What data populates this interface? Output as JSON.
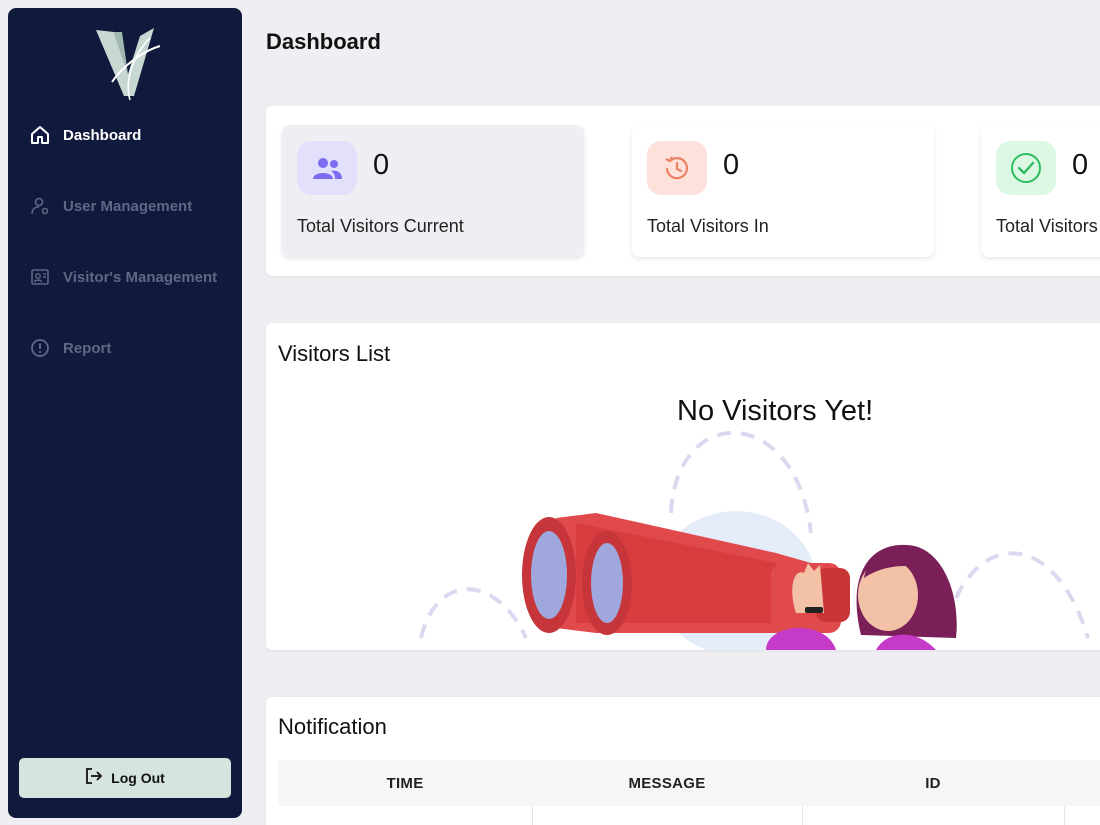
{
  "sidebar": {
    "items": [
      {
        "label": "Dashboard",
        "icon": "home-icon",
        "active": true
      },
      {
        "label": "User Management",
        "icon": "user-gear-icon",
        "active": false
      },
      {
        "label": "Visitor's Management",
        "icon": "id-card-icon",
        "active": false
      },
      {
        "label": "Report",
        "icon": "alert-circle-icon",
        "active": false
      }
    ],
    "logout_label": "Log Out"
  },
  "header": {
    "title": "Dashboard"
  },
  "stats": [
    {
      "value": "0",
      "label": "Total Visitors Current",
      "icon": "users-icon",
      "icon_bg": "#e3e0fb",
      "icon_color": "#7b6cf0"
    },
    {
      "value": "0",
      "label": "Total Visitors In",
      "icon": "history-icon",
      "icon_bg": "#fde1da",
      "icon_color": "#ec8163"
    },
    {
      "value": "0",
      "label": "Total Visitors",
      "icon": "check-circle-icon",
      "icon_bg": "#dcf7e4",
      "icon_color": "#2dbd5e"
    }
  ],
  "visitors_list": {
    "title": "Visitors List",
    "empty_message": "No Visitors Yet!"
  },
  "notification": {
    "title": "Notification",
    "columns": [
      "TIME",
      "MESSAGE",
      "ID"
    ]
  },
  "colors": {
    "sidebar_bg": "#101a3d",
    "logout_bg": "#d5e4dc",
    "page_bg": "#eeeef3"
  }
}
